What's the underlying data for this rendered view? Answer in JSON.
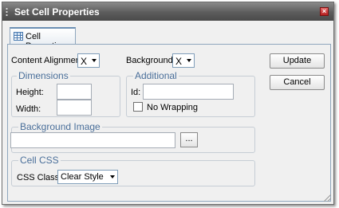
{
  "dialog": {
    "title": "Set Cell Properties",
    "close_icon": "close-icon"
  },
  "tab": {
    "label": "Cell Properties",
    "icon": "table-icon"
  },
  "content_alignment": {
    "label": "Content Alignment:",
    "value": "X"
  },
  "background": {
    "label": "Background:",
    "value": "X"
  },
  "dimensions": {
    "legend": "Dimensions",
    "height_label": "Height:",
    "width_label": "Width:",
    "height_value": "",
    "width_value": ""
  },
  "additional": {
    "legend": "Additional",
    "id_label": "Id:",
    "id_value": "",
    "no_wrapping_label": "No Wrapping",
    "no_wrapping_checked": false
  },
  "background_image": {
    "legend": "Background Image",
    "value": "",
    "browse_label": "..."
  },
  "cell_css": {
    "legend": "Cell CSS",
    "css_class_label": "CSS Class:",
    "css_class_value": "Clear Style"
  },
  "buttons": {
    "update": "Update",
    "cancel": "Cancel"
  }
}
